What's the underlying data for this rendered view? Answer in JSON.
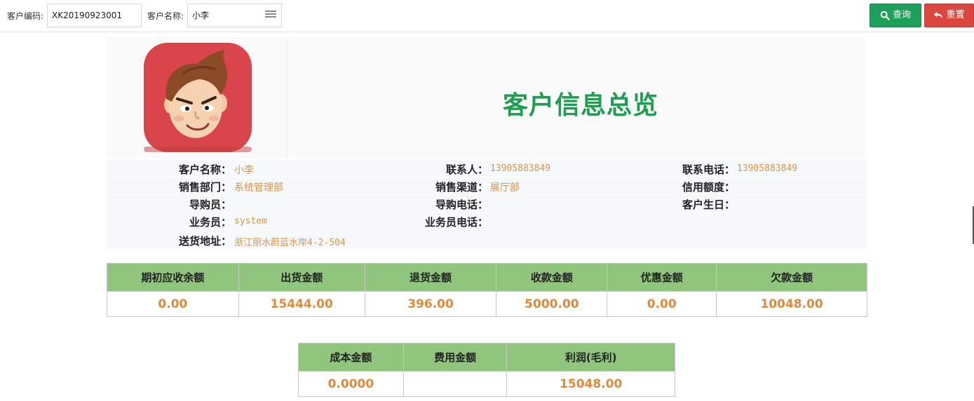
{
  "toolbar": {
    "code_label": "客户编码:",
    "code_value": "XK20190923001",
    "name_label": "客户名称:",
    "name_value": "小李",
    "query_label": "查询",
    "reset_label": "重置"
  },
  "header": {
    "title": "客户信息总览"
  },
  "info": {
    "customer_name_label": "客户名称：",
    "customer_name": "小李",
    "contact_label": "联系人：",
    "contact": "13905883849",
    "phone_label": "联系电话：",
    "phone": "13905883849",
    "dept_label": "销售部门：",
    "dept": "系统管理部",
    "channel_label": "销售渠道：",
    "channel": "展厅部",
    "credit_label": "信用额度：",
    "credit": "",
    "guide_label": "导购员：",
    "guide": "",
    "guide_phone_label": "导购电话：",
    "guide_phone": "",
    "birthday_label": "客户生日：",
    "birthday": "",
    "salesman_label": "业务员：",
    "salesman": "system",
    "salesman_phone_label": "业务员电话：",
    "salesman_phone": "",
    "address_label": "送货地址：",
    "address": "浙江丽水蔚蓝水岸4-2-504"
  },
  "summary1": {
    "headers": [
      "期初应收余额",
      "出货金额",
      "退货金额",
      "收款金额",
      "优惠金额",
      "欠款金额"
    ],
    "values": [
      "0.00",
      "15444.00",
      "396.00",
      "5000.00",
      "0.00",
      "10048.00"
    ]
  },
  "summary2": {
    "headers": [
      "成本金额",
      "费用金额",
      "利润(毛利)"
    ],
    "values": [
      "0.0000",
      "",
      "15048.00"
    ]
  },
  "colors": {
    "title_green": "#1e9e4f",
    "query_green": "#1fa05a",
    "reset_red": "#d9473e",
    "header_green": "#8fc57c",
    "value_orange": "#e0893a",
    "info_orange": "#d9944a"
  },
  "icons": {
    "query": "search-icon",
    "reset": "undo-icon",
    "name_picker": "list-icon"
  }
}
